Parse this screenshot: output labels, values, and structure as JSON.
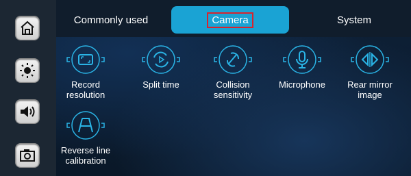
{
  "sidebar": {
    "items": [
      {
        "icon": "home-icon"
      },
      {
        "icon": "brightness-icon"
      },
      {
        "icon": "volume-icon"
      },
      {
        "icon": "camera-icon"
      }
    ]
  },
  "tabs": [
    {
      "label": "Commonly used",
      "active": false
    },
    {
      "label": "Camera",
      "active": true
    },
    {
      "label": "System",
      "active": false
    }
  ],
  "settings": [
    {
      "label": "Record\nresolution",
      "icon": "resolution-icon"
    },
    {
      "label": "Split time",
      "icon": "split-time-icon"
    },
    {
      "label": "Collision\nsensitivity",
      "icon": "collision-icon"
    },
    {
      "label": "Microphone",
      "icon": "microphone-icon"
    },
    {
      "label": "Rear mirror\nimage",
      "icon": "mirror-icon"
    },
    {
      "label": "Reverse line\ncalibration",
      "icon": "reverse-line-icon"
    }
  ],
  "colors": {
    "accent": "#1aa3d4",
    "highlight_border": "#d9232d",
    "icon_stroke": "#2ab4e6"
  }
}
